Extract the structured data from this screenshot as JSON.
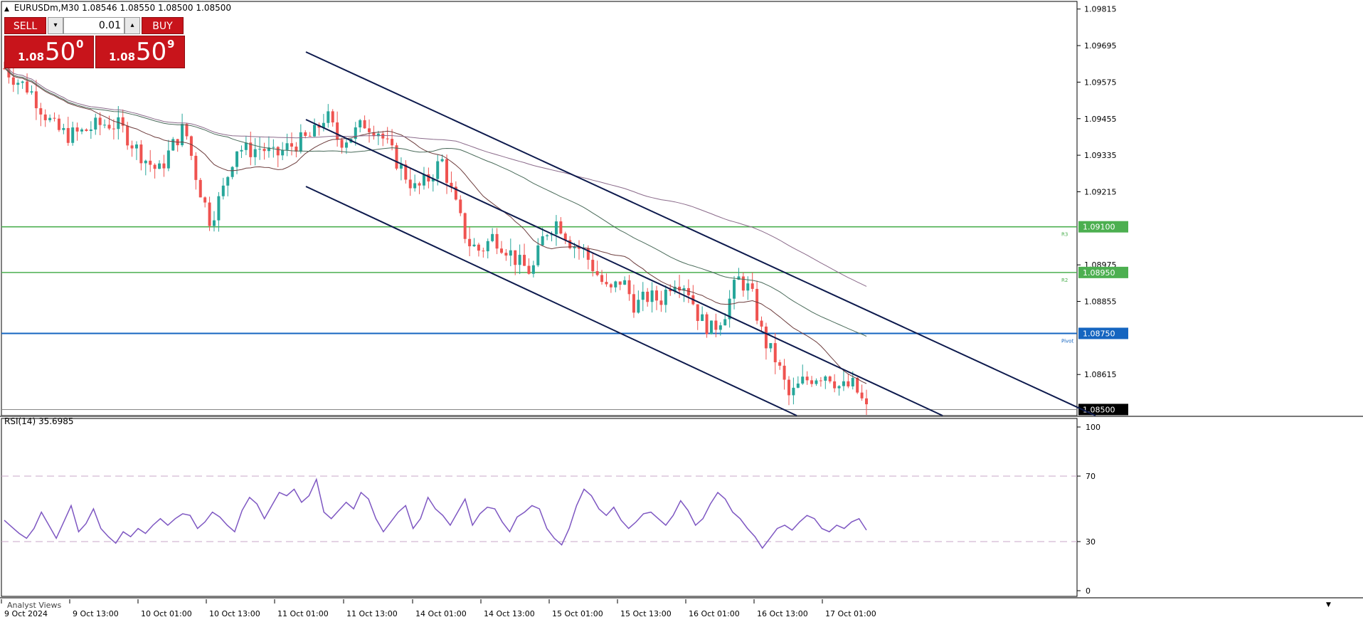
{
  "header": {
    "symbol": "EURUSDm,M30",
    "ohlc": "1.08546 1.08550 1.08500 1.08500"
  },
  "trade_panel": {
    "sell_label": "SELL",
    "buy_label": "BUY",
    "lot": "0.01",
    "sell_price_small": "1.08",
    "sell_price_big": "50",
    "sell_price_sup": "0",
    "buy_price_small": "1.08",
    "buy_price_big": "50",
    "buy_price_sup": "9"
  },
  "rsi_label": "RSI(14) 35.6985",
  "analyst_label": "Analyst Views",
  "colors": {
    "bull": "#26a69a",
    "bear": "#ef5350",
    "green_level": "#4caf50",
    "pivot": "#1565c0",
    "rsi": "#7e57c2",
    "ma": "#5d3a3a"
  },
  "chart_data": {
    "type": "candlestick",
    "symbol": "EURUSDm",
    "timeframe": "M30",
    "y_ticks": [
      1.09815,
      1.09695,
      1.09575,
      1.09455,
      1.09335,
      1.09215,
      1.08975,
      1.08855,
      1.08615
    ],
    "y_range": [
      1.0848,
      1.0984
    ],
    "x_ticks": [
      "9 Oct 2024",
      "9 Oct 13:00",
      "10 Oct 01:00",
      "10 Oct 13:00",
      "11 Oct 01:00",
      "11 Oct 13:00",
      "14 Oct 01:00",
      "14 Oct 13:00",
      "15 Oct 01:00",
      "15 Oct 13:00",
      "16 Oct 01:00",
      "16 Oct 13:00",
      "17 Oct 01:00"
    ],
    "levels": [
      {
        "label": "1.09100",
        "value": 1.091,
        "tag": "R3",
        "color": "#4caf50"
      },
      {
        "label": "1.08950",
        "value": 1.0895,
        "tag": "R2",
        "color": "#4caf50"
      },
      {
        "label": "1.08750",
        "value": 1.0875,
        "tag": "Pivot",
        "color": "#1565c0"
      }
    ],
    "current_price": {
      "label": "1.08500",
      "value": 1.085
    },
    "price_path": [
      1.0962,
      1.0958,
      1.0955,
      1.0948,
      1.0942,
      1.094,
      1.0941,
      1.0943,
      1.0944,
      1.0943,
      1.0937,
      1.0932,
      1.0928,
      1.0936,
      1.0943,
      1.0925,
      1.0912,
      1.0922,
      1.0936,
      1.0935,
      1.0936,
      1.0933,
      1.0936,
      1.0938,
      1.094,
      1.0947,
      1.0938,
      1.094,
      1.0944,
      1.0942,
      1.0935,
      1.0928,
      1.0922,
      1.0926,
      1.0932,
      1.0918,
      1.0905,
      1.0902,
      1.0907,
      1.0903,
      1.0898,
      1.0895,
      1.0908,
      1.0912,
      1.0905,
      1.0902,
      1.0895,
      1.0888,
      1.0893,
      1.0884,
      1.0887,
      1.0886,
      1.0893,
      1.0891,
      1.088,
      1.0876,
      1.0882,
      1.0893,
      1.0889,
      1.0873,
      1.0866,
      1.0854,
      1.0859,
      1.0861,
      1.0862,
      1.0857,
      1.0858,
      1.085
    ],
    "rsi": {
      "label": "RSI(14)",
      "value": 35.6985,
      "levels": [
        70,
        30
      ],
      "y_ticks": [
        100,
        70,
        30,
        0
      ],
      "series": [
        43,
        39,
        35,
        32,
        38,
        48,
        40,
        32,
        42,
        52,
        36,
        41,
        50,
        38,
        33,
        29,
        36,
        33,
        38,
        35,
        40,
        44,
        40,
        44,
        47,
        46,
        38,
        42,
        48,
        45,
        40,
        36,
        49,
        57,
        53,
        44,
        52,
        60,
        58,
        62,
        54,
        58,
        68,
        48,
        44,
        49,
        54,
        50,
        60,
        56,
        44,
        36,
        42,
        48,
        52,
        38,
        44,
        57,
        50,
        46,
        40,
        48,
        56,
        40,
        47,
        51,
        50,
        42,
        36,
        45,
        48,
        52,
        50,
        38,
        32,
        28,
        38,
        52,
        62,
        58,
        50,
        46,
        51,
        43,
        38,
        42,
        47,
        48,
        44,
        40,
        46,
        55,
        49,
        40,
        44,
        53,
        60,
        56,
        48,
        44,
        38,
        33,
        26,
        32,
        38,
        40,
        37,
        42,
        46,
        44,
        38,
        36,
        40,
        38,
        42,
        44,
        37
      ]
    }
  }
}
